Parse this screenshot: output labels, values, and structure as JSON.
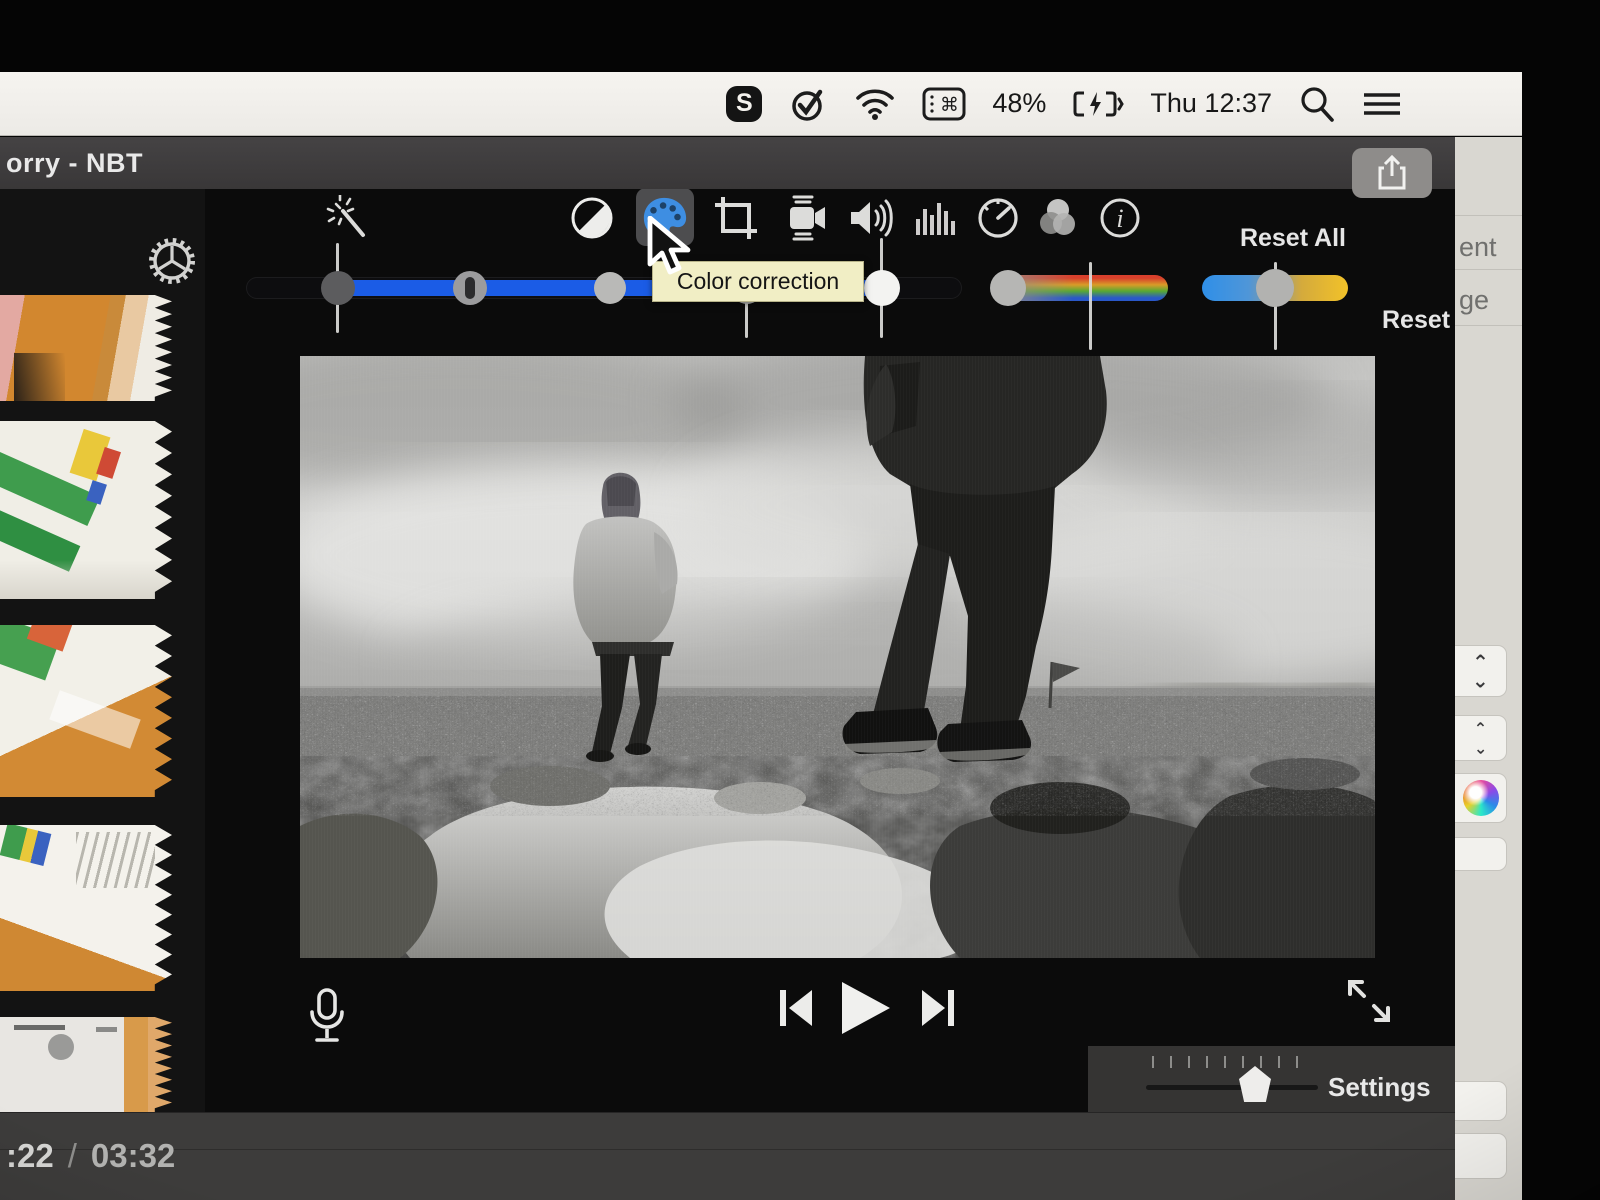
{
  "menu_bar": {
    "skype_letter": "S",
    "battery_percent": "48%",
    "clock": "Thu 12:37",
    "icons": [
      "skype",
      "checkmark",
      "wifi",
      "keyboard-viewer",
      "battery-charging",
      "spotlight-search",
      "notification-center"
    ]
  },
  "window": {
    "title": "orry - NBT"
  },
  "toolbar": {
    "tools": [
      "auto-enhance",
      "color-balance",
      "color-correction",
      "crop",
      "stabilization",
      "volume",
      "noise-reduction",
      "speed",
      "clip-filter",
      "clip-info"
    ],
    "selected_tool": "color-correction",
    "info_glyph": "i",
    "reset_all_label": "Reset All"
  },
  "color_correction": {
    "tooltip": "Color correction",
    "reset_label": "Reset",
    "colors": {
      "accent_blue": "#1b5ce6",
      "palette_blue": "#3e8ee2",
      "tooltip_bg": "#f1eec5"
    }
  },
  "transport": {
    "icons": [
      "record-voiceover-mic",
      "skip-back",
      "play",
      "skip-forward",
      "fullscreen"
    ]
  },
  "bottom_bar": {
    "settings_label": "Settings"
  },
  "timeline": {
    "current_time": ":22",
    "separator": "/",
    "total_time": "03:32"
  },
  "background_window": {
    "fragment_texts": [
      "ent",
      "ge"
    ]
  }
}
